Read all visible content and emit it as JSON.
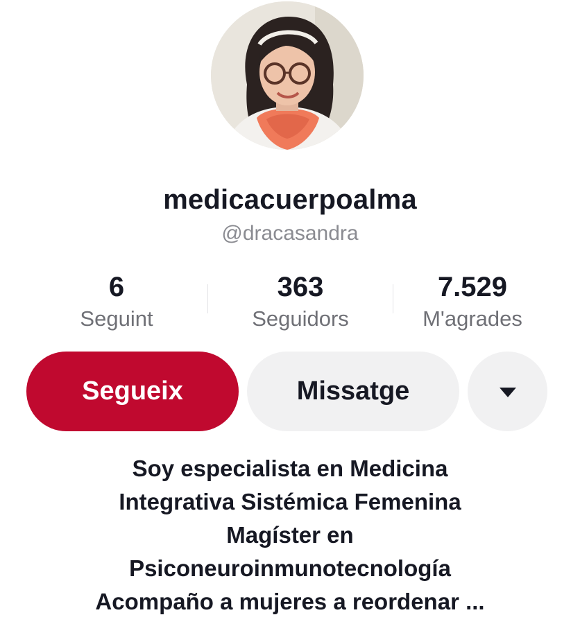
{
  "profile": {
    "username": "medicacuerpoalma",
    "handle": "@dracasandra"
  },
  "stats": {
    "following": {
      "value": "6",
      "label": "Seguint"
    },
    "followers": {
      "value": "363",
      "label": "Seguidors"
    },
    "likes": {
      "value": "7.529",
      "label": "M'agrades"
    }
  },
  "actions": {
    "follow_label": "Segueix",
    "message_label": "Missatge",
    "more_icon": "caret-down-icon"
  },
  "bio": {
    "lines": [
      "Soy especialista en Medicina",
      "Integrativa Sistémica Femenina",
      "Magíster en",
      "Psiconeuroinmunotecnología",
      "Acompaño a mujeres a reordenar ..."
    ]
  },
  "colors": {
    "follow_button": "#c0092f",
    "secondary_button": "#f1f1f2",
    "text_primary": "#161823",
    "text_secondary": "#8a8b91"
  }
}
